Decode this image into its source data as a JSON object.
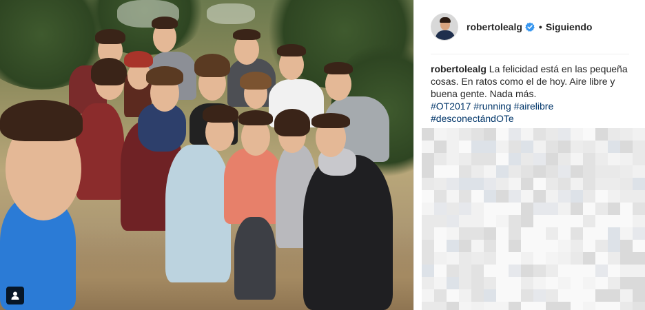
{
  "post": {
    "username": "robertolealg",
    "separator": "•",
    "follow_status": "Siguiendo",
    "caption_username": "robertolealg",
    "caption_text": "La felicidad está en las pequeña cosas. En ratos como el de hoy. Aire libre y buena gente. Nada más.",
    "hashtags": [
      "#OT2017",
      "#running",
      "#airelibre",
      "#desconectándOTe"
    ],
    "icons": {
      "verified": "verified-badge-icon",
      "user_tag": "user-tag-icon"
    }
  },
  "colors": {
    "hashtag": "#003569",
    "verified": "#3897f0",
    "text": "#262626"
  }
}
